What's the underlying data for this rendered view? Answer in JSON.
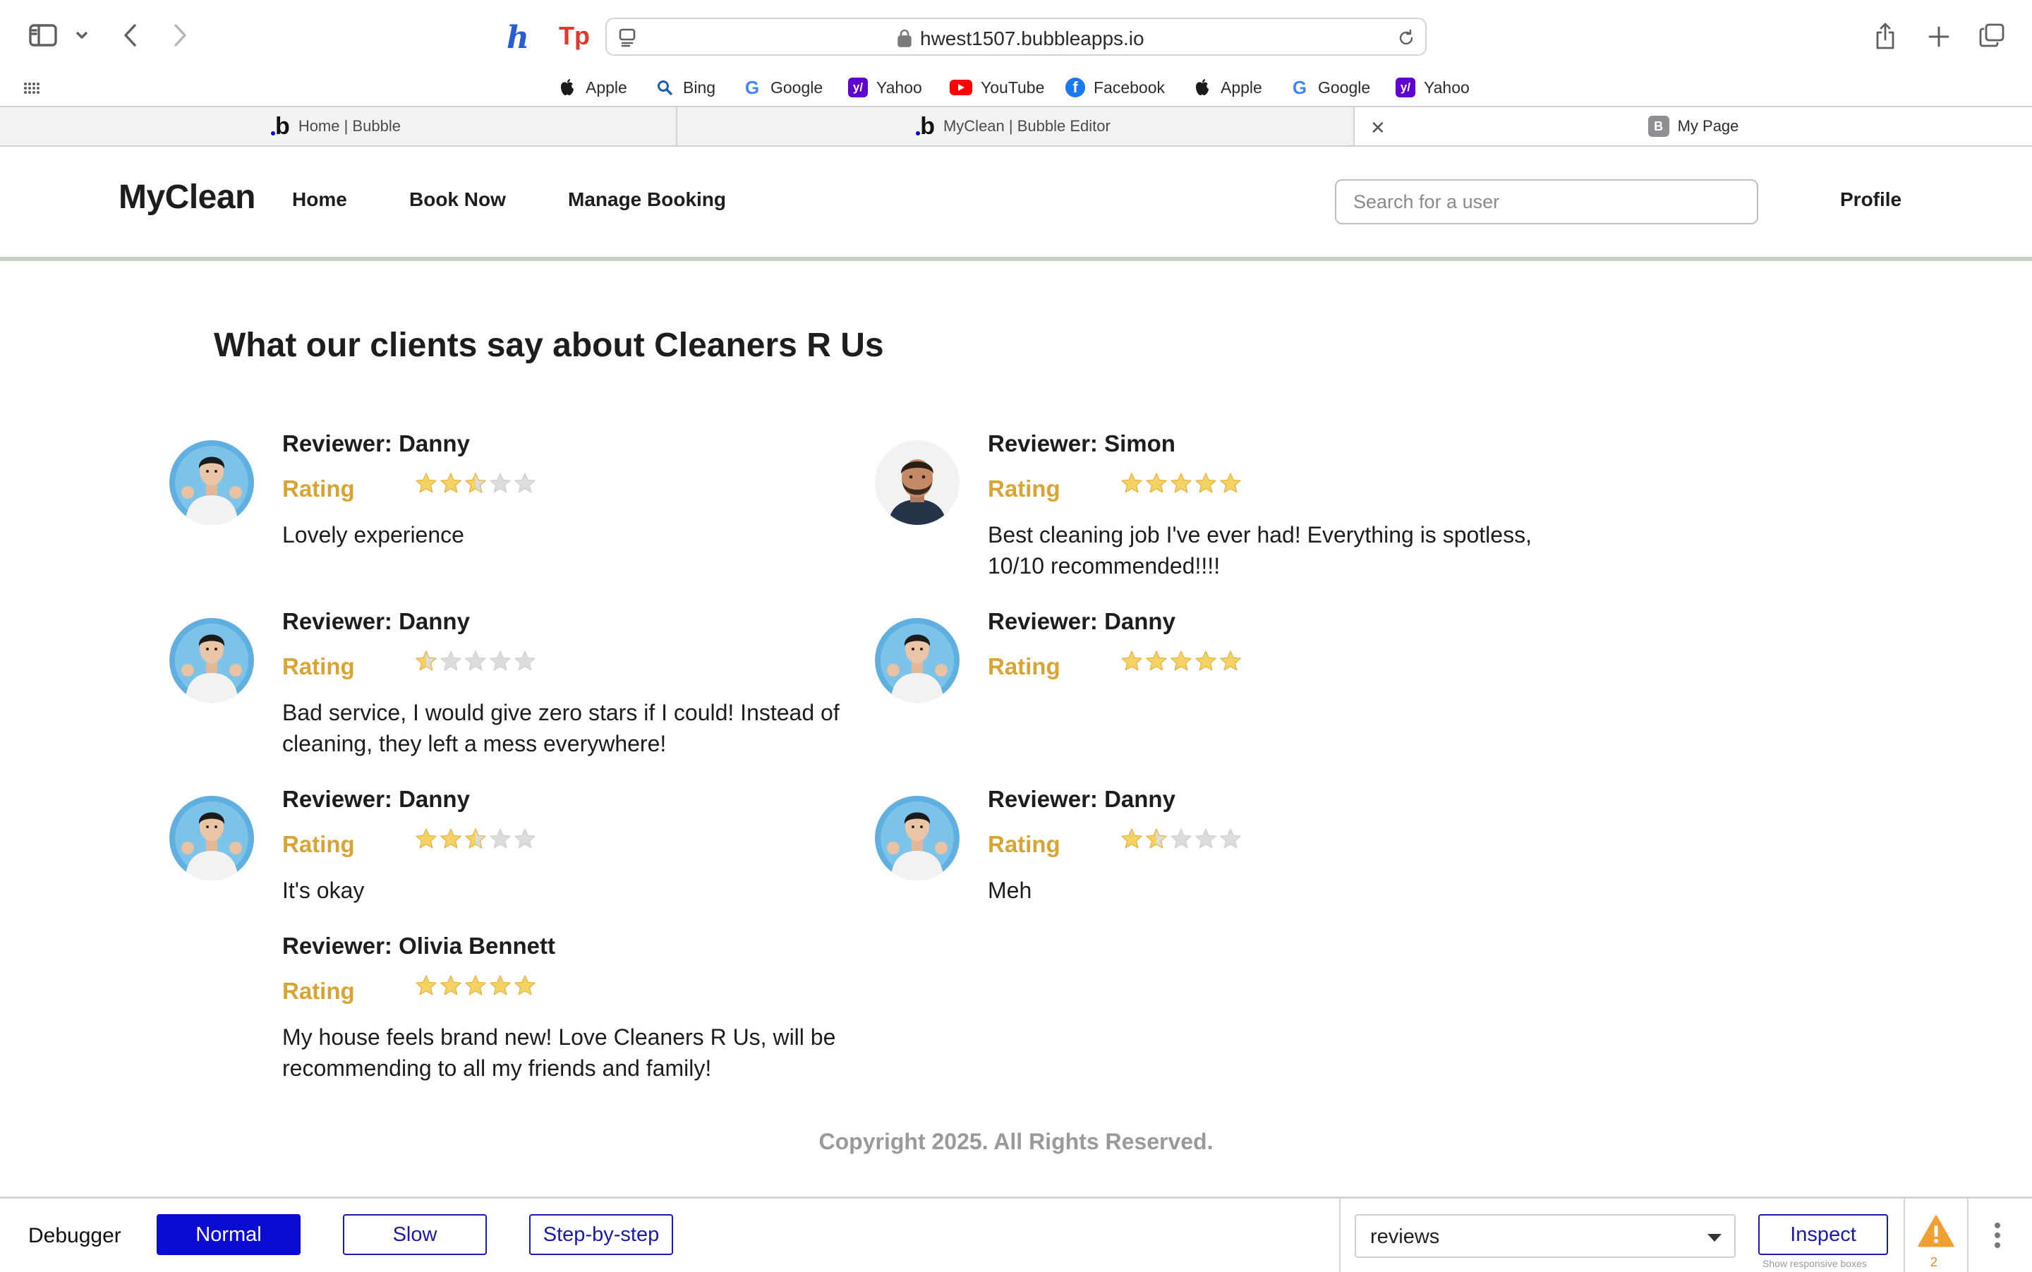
{
  "browser": {
    "url": "hwest1507.bubbleapps.io",
    "favorites": [
      {
        "label": "Apple",
        "icon": "apple-icon"
      },
      {
        "label": "Bing",
        "icon": "bing-search-icon"
      },
      {
        "label": "Google",
        "icon": "google-icon"
      },
      {
        "label": "Yahoo",
        "icon": "yahoo-icon"
      },
      {
        "label": "YouTube",
        "icon": "youtube-icon"
      },
      {
        "label": "Facebook",
        "icon": "facebook-icon"
      },
      {
        "label": "Apple",
        "icon": "apple-icon"
      },
      {
        "label": "Google",
        "icon": "google-icon"
      },
      {
        "label": "Yahoo",
        "icon": "yahoo-icon"
      }
    ],
    "tabs": [
      {
        "title": "Home | Bubble",
        "icon": "bubble-icon"
      },
      {
        "title": "MyClean | Bubble Editor",
        "icon": "bubble-icon"
      },
      {
        "title": "My Page",
        "icon": "b-favicon"
      }
    ],
    "extension_icons": {
      "h": "h",
      "tp": "Tp"
    }
  },
  "header": {
    "logo": "MyClean",
    "nav": [
      "Home",
      "Book Now",
      "Manage Booking"
    ],
    "search_placeholder": "Search for a user",
    "profile": "Profile"
  },
  "main": {
    "title": "What our clients say about Cleaners R Us",
    "rating_label": "Rating",
    "reviews": [
      {
        "reviewer": "Reviewer: Danny",
        "rating": 2.5,
        "text": "Lovely experience",
        "avatar": "danny"
      },
      {
        "reviewer": "Reviewer: Simon",
        "rating": 5,
        "text": "Best cleaning job I've ever had! Everything is spotless, 10/10 recommended!!!!",
        "avatar": "simon"
      },
      {
        "reviewer": "Reviewer: Danny",
        "rating": 0.5,
        "text": "Bad service, I would give zero stars if I could! Instead of cleaning, they left a mess everywhere!",
        "avatar": "danny"
      },
      {
        "reviewer": "Reviewer: Danny",
        "rating": 5,
        "text": "",
        "avatar": "danny"
      },
      {
        "reviewer": "Reviewer: Danny",
        "rating": 2.5,
        "text": "It's okay",
        "avatar": "danny"
      },
      {
        "reviewer": "Reviewer: Danny",
        "rating": 1.5,
        "text": "Meh",
        "avatar": "danny"
      },
      {
        "reviewer": "Reviewer: Olivia Bennett",
        "rating": 5,
        "text": "My house feels brand new! Love Cleaners R Us, will be recommending to all my friends and family!",
        "avatar": "none"
      }
    ]
  },
  "footer": {
    "copyright": "Copyright 2025. All Rights Reserved."
  },
  "debugger": {
    "label": "Debugger",
    "modes": [
      "Normal",
      "Slow",
      "Step-by-step"
    ],
    "active_mode": "Normal",
    "element_select": "reviews",
    "inspect": "Inspect",
    "responsive_note": "Show responsive boxes",
    "warning_count": "2"
  },
  "colors": {
    "rating_gold": "#d8a434",
    "star_fill": "#f5d264",
    "star_empty": "#dcdcdc",
    "debugger_blue": "#0b0bd4",
    "header_rule": "#c9d0c4"
  }
}
